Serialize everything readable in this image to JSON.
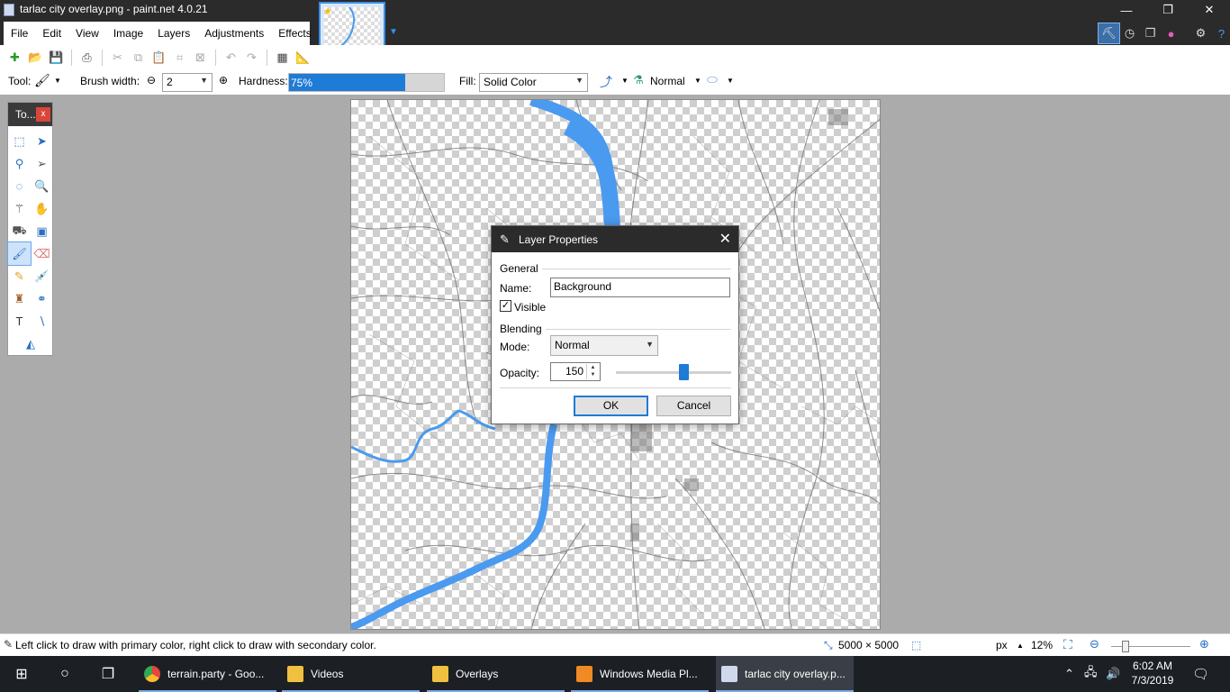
{
  "window": {
    "title": "tarlac city overlay.png - paint.net 4.0.21"
  },
  "menu": [
    "File",
    "Edit",
    "View",
    "Image",
    "Layers",
    "Adjustments",
    "Effects"
  ],
  "toolbar": {
    "tool_label": "Tool:",
    "brush_width_label": "Brush width:",
    "brush_width_value": "2",
    "hardness_label": "Hardness:",
    "hardness_value": "75%",
    "hardness_fraction": 0.75,
    "fill_label": "Fill:",
    "fill_value": "Solid Color",
    "blend_mode": "Normal"
  },
  "tools_panel": {
    "title": "To...",
    "close": "x"
  },
  "dialog": {
    "title": "Layer Properties",
    "general_label": "General",
    "name_label": "Name:",
    "name_value": "Background",
    "visible_label": "Visible",
    "visible_checked": true,
    "blending_label": "Blending",
    "mode_label": "Mode:",
    "mode_value": "Normal",
    "opacity_label": "Opacity:",
    "opacity_value": "150",
    "opacity_fraction": 0.588,
    "ok_label": "OK",
    "cancel_label": "Cancel"
  },
  "statusbar": {
    "hint": "Left click to draw with primary color, right click to draw with secondary color.",
    "image_size": "5000 × 5000",
    "units": "px",
    "zoom": "12%"
  },
  "taskbar": {
    "apps": [
      {
        "label": "terrain.party - Goo...",
        "color": "#e8453c"
      },
      {
        "label": "Videos",
        "color": "#f0c040"
      },
      {
        "label": "Overlays",
        "color": "#f0c040"
      },
      {
        "label": "Windows Media Pl...",
        "color": "#f08a24"
      },
      {
        "label": "tarlac city overlay.p...",
        "color": "#cfd9ee"
      }
    ],
    "time": "6:02 AM",
    "date": "7/3/2019"
  },
  "colors": {
    "accent": "#1e7bd6",
    "titlebar": "#2b2b2b",
    "river": "#4a9af0"
  }
}
